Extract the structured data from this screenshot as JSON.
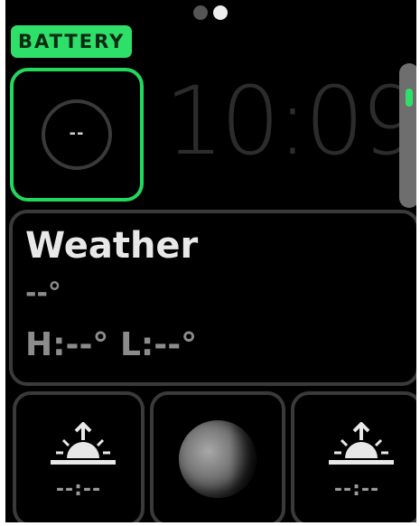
{
  "page_indicator": {
    "count": 2,
    "active_index": 1
  },
  "battery": {
    "badge_label": "BATTERY",
    "value": "--",
    "accent_color": "#2ee06a"
  },
  "clock": {
    "time": "10:09"
  },
  "scroll": {
    "thumb_color": "#2ee06a"
  },
  "weather": {
    "title": "Weather",
    "temperature": "--°",
    "high_low": "H:--° L:--°"
  },
  "bottom": {
    "sunrise": {
      "icon": "sunrise-icon",
      "time": "--:--"
    },
    "moon": {
      "icon": "moon-phase-icon"
    },
    "sunset": {
      "icon": "sunset-icon",
      "time": "--:--"
    }
  }
}
